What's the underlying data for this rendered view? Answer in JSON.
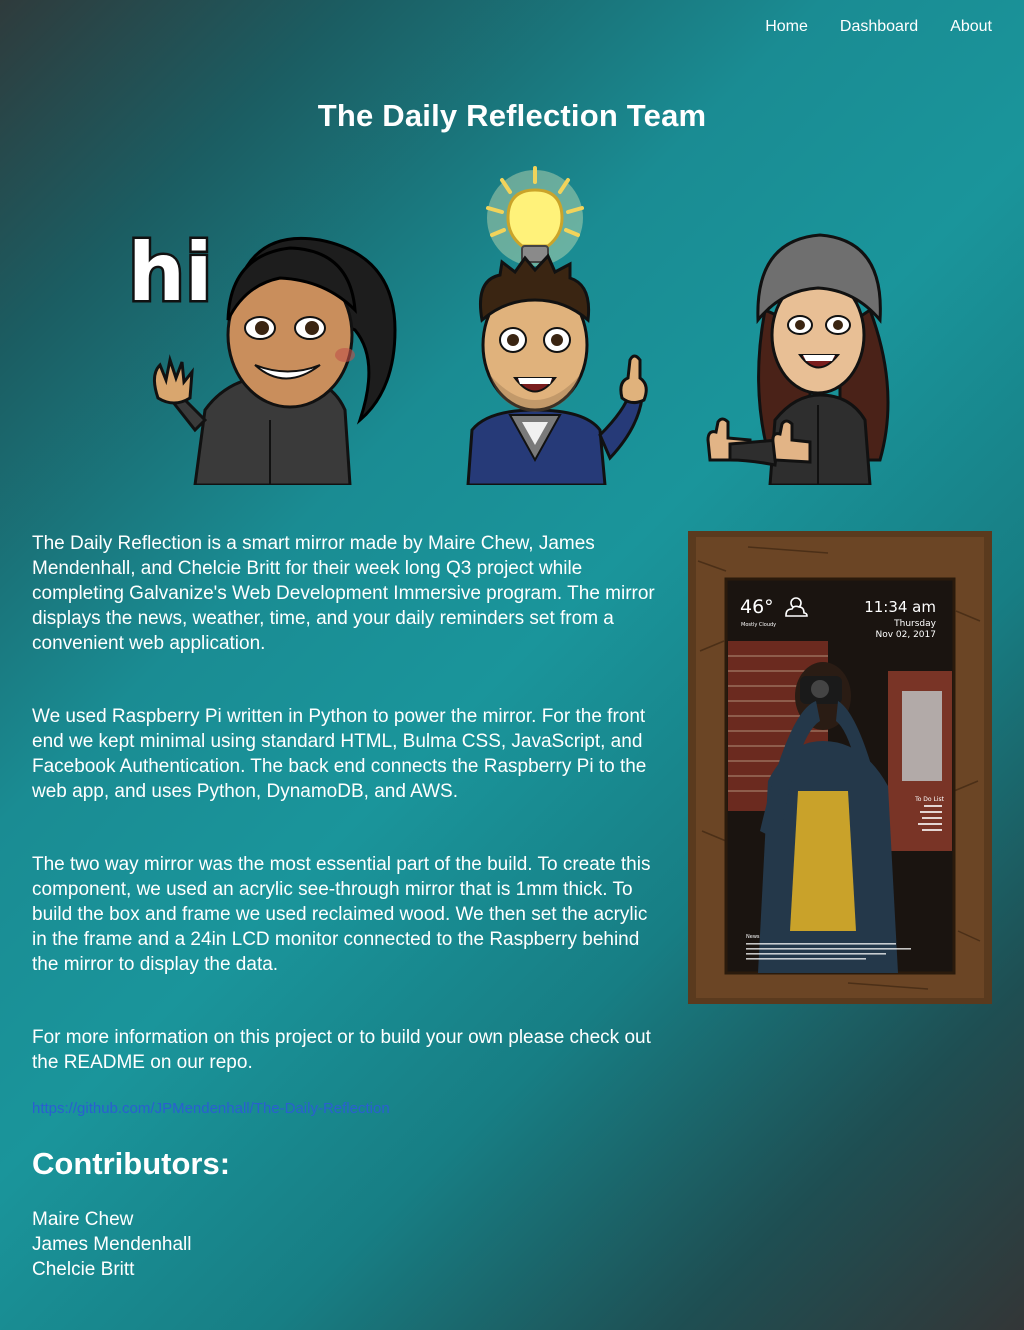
{
  "nav": {
    "items": [
      {
        "label": "Home"
      },
      {
        "label": "Dashboard"
      },
      {
        "label": "About"
      }
    ]
  },
  "header": {
    "title": "The Daily Reflection Team"
  },
  "avatars": {
    "hi_text": "hi"
  },
  "description": {
    "paragraphs": [
      "The Daily Reflection is a smart mirror made by Maire Chew, James Mendenhall, and Chelcie Britt for their week long Q3 project while completing Galvanize's Web Development Immersive program. The mirror displays the news, weather, time, and your daily reminders set from a convenient web application.",
      "We used Raspberry Pi written in Python to power the mirror. For the front end we kept minimal using standard HTML, Bulma CSS, JavaScript, and Facebook Authentication. The back end connects the Raspberry Pi to the web app, and uses Python, DynamoDB, and AWS.",
      "The two way mirror was the most essential part of the build. To create this component, we used an acrylic see-through mirror that is 1mm thick. To build the box and frame we used reclaimed wood. We then set the acrylic in the frame and a 24in LCD monitor connected to the Raspberry behind the mirror to display the data.",
      "For more information on this project or to build your own please check out the README on our repo."
    ],
    "repo_url": "https://github.com/JPMendenhall/The-Daily-Reflection"
  },
  "contributors": {
    "title": "Contributors:",
    "names": [
      "Maire Chew",
      "James Mendenhall",
      "Chelcie Britt"
    ]
  },
  "mirror": {
    "temperature": "46°",
    "weather_desc": "Mostly Cloudy",
    "time": "11:34 am",
    "day": "Thursday",
    "date": "Nov 02, 2017",
    "todo_title": "To Do List",
    "news_title": "News"
  },
  "colors": {
    "link": "#2a5fd0",
    "text": "#ffffff",
    "frame_wood": "#5a3a1e"
  }
}
